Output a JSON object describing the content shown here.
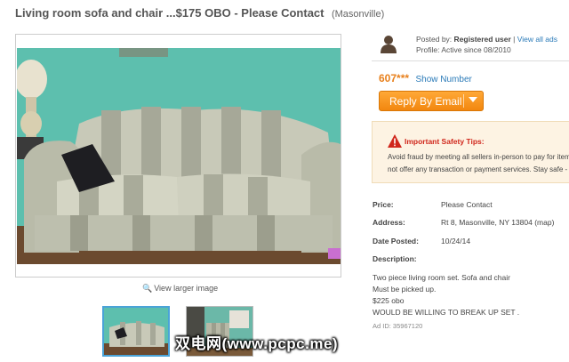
{
  "listing": {
    "title": "Living room sofa and chair ...$175 OBO - Please Contact",
    "location": "(Masonville)"
  },
  "gallery": {
    "view_larger": "View larger image",
    "thumb_count": 2,
    "active_thumb": 1
  },
  "poster": {
    "posted_by_label": "Posted by:",
    "posted_by_value": "Registered user",
    "separator": "|",
    "view_all_ads": "View all ads",
    "profile": "Profile: Active since 08/2010"
  },
  "contact": {
    "phone_partial": "607***",
    "show_number": "Show Number",
    "reply_button": "Reply By Email"
  },
  "safety": {
    "title": "Important Safety Tips:",
    "line1": "Avoid fraud by meeting all sellers in-person to pay for items",
    "line2": "not offer any transaction or payment services. Stay safe -"
  },
  "details": {
    "price_label": "Price:",
    "price_value": "Please Contact",
    "address_label": "Address:",
    "address_value": "Rt 8, Masonville, NY 13804 (map)",
    "date_label": "Date Posted:",
    "date_value": "10/24/14",
    "description_label": "Description:",
    "description_lines": [
      "Two piece living room set. Sofa and chair",
      "Must be picked up.",
      "$225 obo",
      "WOULD BE WILLING TO BREAK UP SET ."
    ],
    "ad_id": "Ad ID: 35967120"
  },
  "watermark": "双电网(www.pcpc.me)",
  "colors": {
    "accent_orange": "#e8801c",
    "link_blue": "#2a7ab8",
    "warning_red": "#d0261b",
    "safety_bg": "#fdf3e3",
    "wall_teal": "#5dbfae"
  },
  "icons": {
    "view_larger": "magnifier-icon",
    "poster": "person-silhouette-icon",
    "safety": "warning-triangle-icon",
    "reply_dropdown": "caret-down-icon"
  }
}
